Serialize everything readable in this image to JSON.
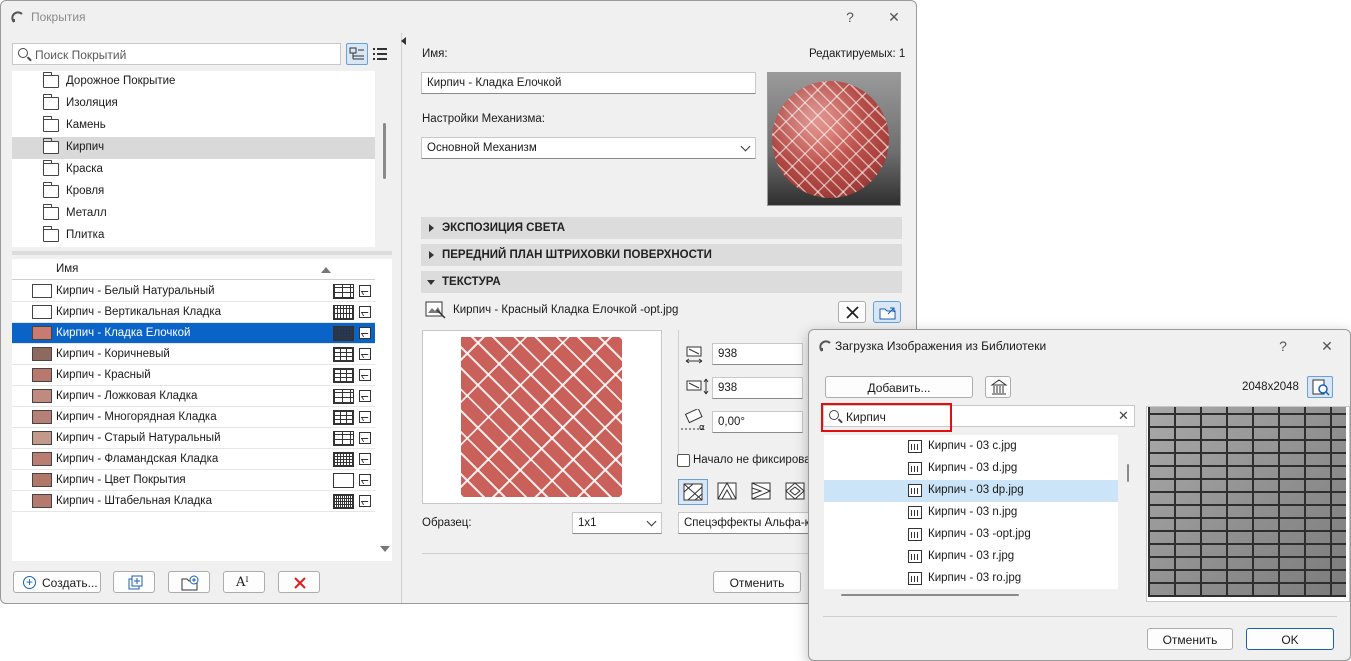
{
  "main": {
    "title": "Покрытия",
    "help": "?",
    "close": "✕",
    "search_placeholder": "Поиск Покрытий",
    "folders": [
      "Дорожное Покрытие",
      "Изоляция",
      "Камень",
      "Кирпич",
      "Краска",
      "Кровля",
      "Металл",
      "Плитка"
    ],
    "list_header": "Имя",
    "materials": [
      {
        "name": "Кирпич - Белый Натуральный",
        "color": "#ffffff",
        "hatch": "sparse"
      },
      {
        "name": "Кирпич - Вертикальная Кладка",
        "color": "#ffffff",
        "hatch": "vert"
      },
      {
        "name": "Кирпич - Кладка Елочкой",
        "color": "#c97b72",
        "hatch": "dense"
      },
      {
        "name": "Кирпич - Коричневый",
        "color": "#8e6a5e",
        "hatch": "bricks"
      },
      {
        "name": "Кирпич - Красный",
        "color": "#b9786e",
        "hatch": "bricks"
      },
      {
        "name": "Кирпич - Ложковая Кладка",
        "color": "#c08a80",
        "hatch": "sparse"
      },
      {
        "name": "Кирпич - Многорядная Кладка",
        "color": "#b48078",
        "hatch": "bricks"
      },
      {
        "name": "Кирпич - Старый Натуральный",
        "color": "#c29a8c",
        "hatch": "sparse"
      },
      {
        "name": "Кирпич - Фламандская Кладка",
        "color": "#b97d72",
        "hatch": "dense"
      },
      {
        "name": "Кирпич - Цвет Покрытия",
        "color": "#b07868",
        "hatch": "none"
      },
      {
        "name": "Кирпич - Штабельная Кладка",
        "color": "#b57a6e",
        "hatch": "grid"
      }
    ],
    "create_label": "Создать...",
    "name_label": "Имя:",
    "editable_label": "Редактируемых: 1",
    "name_value": "Кирпич - Кладка Елочкой",
    "engine_label": "Настройки Механизма:",
    "engine_value": "Основной Механизм",
    "sections": [
      "ЭКСПОЗИЦИЯ СВЕТА",
      "ПЕРЕДНИЙ ПЛАН ШТРИХОВКИ ПОВЕРХНОСТИ",
      "ТЕКСТУРА"
    ],
    "texture_name": "Кирпич - Красный Кладка Елочкой -opt.jpg",
    "width_value": "938",
    "height_value": "938",
    "angle_value": "0,00°",
    "start_label": "Начало не фиксирова",
    "sample_label": "Образец:",
    "sample_value": "1x1",
    "alpha_value": "Спецэффекты Альфа-ка",
    "cancel_label": "Отменить"
  },
  "library": {
    "title": "Загрузка Изображения из Библиотеки",
    "help": "?",
    "close": "✕",
    "add_label": "Добавить...",
    "size_label": "2048x2048",
    "search_value": "Кирпич",
    "clear": "✕",
    "files": [
      "Кирпич - 03 c.jpg",
      "Кирпич - 03 d.jpg",
      "Кирпич - 03 dp.jpg",
      "Кирпич - 03 n.jpg",
      "Кирпич - 03 -opt.jpg",
      "Кирпич - 03 r.jpg",
      "Кирпич - 03 ro.jpg"
    ],
    "cancel_label": "Отменить",
    "ok_label": "OK"
  }
}
